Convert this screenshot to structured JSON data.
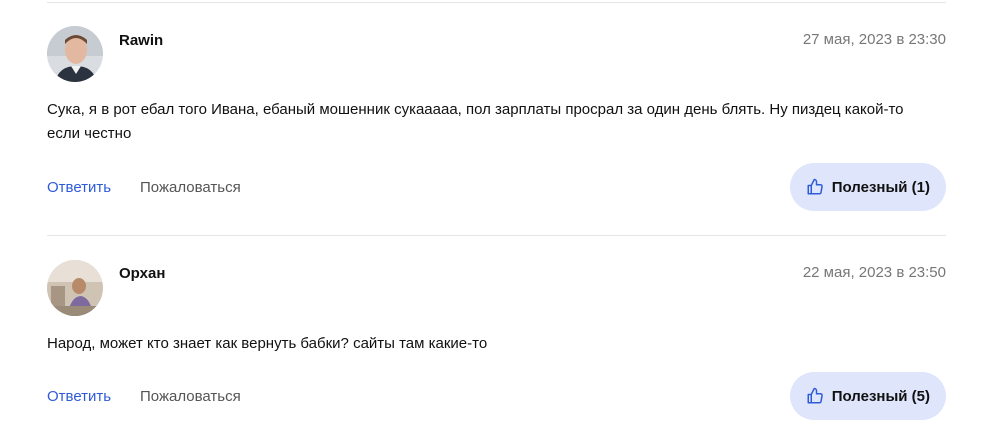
{
  "reviews": [
    {
      "author": "Rawin",
      "date": "27 мая, 2023 в 23:30",
      "text": "Сука, я в рот ебал того Ивана, ебаный мошенник сукааааа, пол зарплаты просрал за один день блять. Ну пиздец какой-то если честно",
      "reply_label": "Ответить",
      "complain_label": "Пожаловаться",
      "helpful_label": "Полезный (1)",
      "avatar_icon": "user-photo-avatar"
    },
    {
      "author": "Орхан",
      "date": "22 мая, 2023 в 23:50",
      "text": "Народ, может кто знает как вернуть бабки? сайты там какие-то",
      "reply_label": "Ответить",
      "complain_label": "Пожаловаться",
      "helpful_label": "Полезный (5)",
      "avatar_icon": "user-photo-avatar"
    }
  ],
  "colors": {
    "link": "#2f5bd9",
    "helpful_bg": "#dfe6fb",
    "muted": "#777777"
  }
}
